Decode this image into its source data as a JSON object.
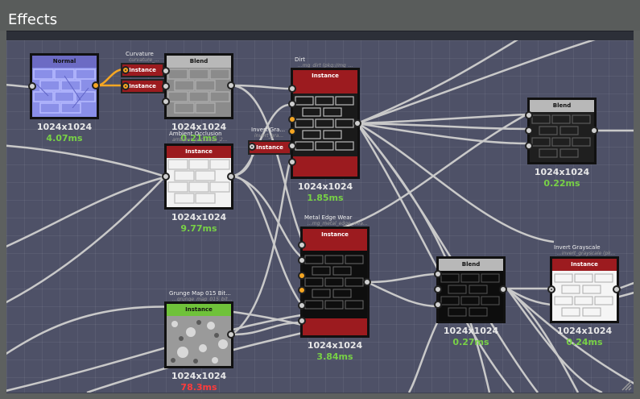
{
  "panel": {
    "title": "Effects"
  },
  "colors": {
    "wire": "#c9c9c9",
    "selected_wire": "#f5a623",
    "good_time": "#78d146",
    "bad_time": "#ff3b3b"
  },
  "nodes": {
    "normal": {
      "header": "Normal",
      "resolution": "1024x1024",
      "time": "4.07ms"
    },
    "curvature": {
      "caption": "Curvature",
      "subcaption": "curvature_...",
      "header": "Instance"
    },
    "blend1": {
      "header": "Blend",
      "resolution": "1024x1024",
      "time": "0.21ms"
    },
    "ambient_occlusion": {
      "caption": "Ambient Occlusion",
      "subcaption": "ambient_occlusion_2...",
      "header": "Instance",
      "resolution": "1024x1024",
      "time": "9.77ms"
    },
    "invert_gray": {
      "caption": "Invert Gra...",
      "subcaption": "invert_gra...",
      "header": "Instance"
    },
    "dirt": {
      "caption": "Dirt",
      "subcaption": "...mg_dirt (pkg://mg_...",
      "header": "Instance",
      "resolution": "1024x1024",
      "time": "1.85ms"
    },
    "blend2": {
      "header": "Blend",
      "resolution": "1024x1024",
      "time": "0.22ms"
    },
    "metal_edge_wear": {
      "caption": "Metal Edge Wear",
      "subcaption": "...mg_metal_edge_wea...",
      "header": "Instance",
      "resolution": "1024x1024",
      "time": "3.84ms"
    },
    "grunge_map": {
      "caption": "Grunge Map 015 Bit...",
      "subcaption": "...grunge_map_015_bit...",
      "header": "Instance",
      "resolution": "1024x1024",
      "time": "78.3ms"
    },
    "blend3": {
      "header": "Blend",
      "resolution": "1024x1024",
      "time": "0.27ms"
    },
    "invert_grayscale": {
      "caption": "Invert Grayscale",
      "subcaption": "...invert_grayscale (pk...",
      "header": "Instance",
      "resolution": "1024x1024",
      "time": "0.24ms"
    }
  }
}
